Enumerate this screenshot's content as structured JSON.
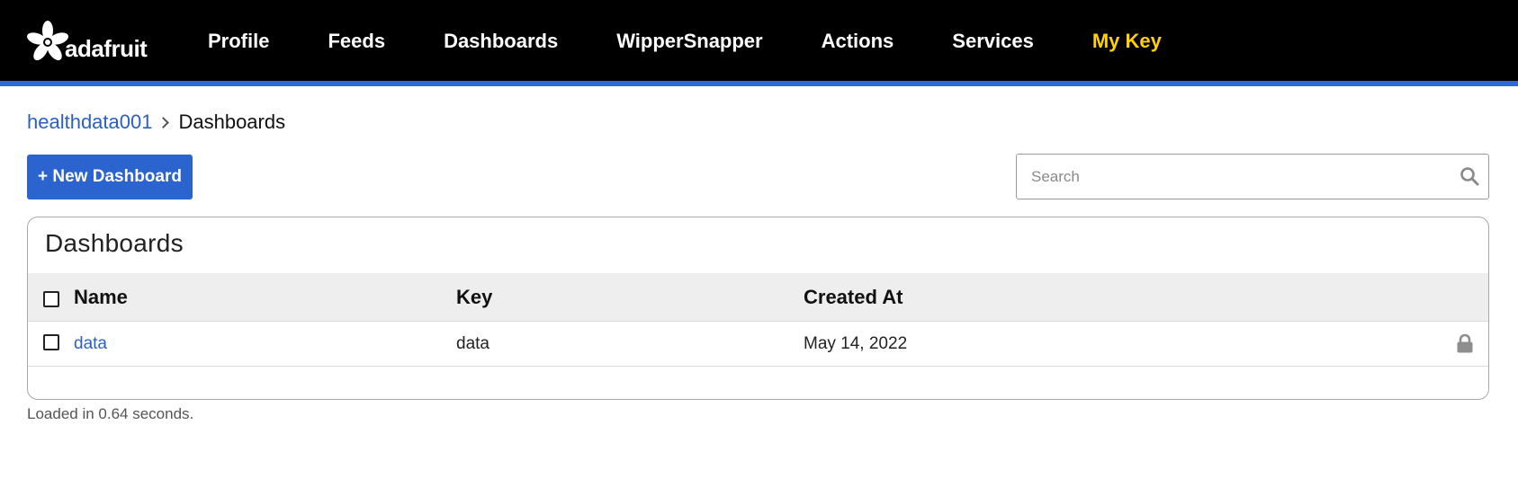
{
  "brand": {
    "name": "adafruit",
    "logo_icon": "adafruit-flower-icon"
  },
  "nav": {
    "items": [
      {
        "label": "Profile"
      },
      {
        "label": "Feeds"
      },
      {
        "label": "Dashboards"
      },
      {
        "label": "WipperSnapper"
      },
      {
        "label": "Actions"
      },
      {
        "label": "Services"
      },
      {
        "label": "My Key",
        "highlighted": true
      }
    ],
    "highlight_color": "#ffd200",
    "accent_bar_color": "#2f6ad9"
  },
  "breadcrumb": {
    "user": "healthdata001",
    "current": "Dashboards"
  },
  "toolbar": {
    "new_button_label": "+ New Dashboard",
    "search_placeholder": "Search",
    "search_value": "",
    "button_color": "#2b63cf"
  },
  "panel": {
    "title": "Dashboards",
    "columns": {
      "name": "Name",
      "key": "Key",
      "created": "Created At"
    },
    "rows": [
      {
        "name": "data",
        "key": "data",
        "created": "May 14, 2022",
        "icon": "lock-icon"
      }
    ]
  },
  "footer": {
    "load_text": "Loaded in 0.64 seconds."
  }
}
